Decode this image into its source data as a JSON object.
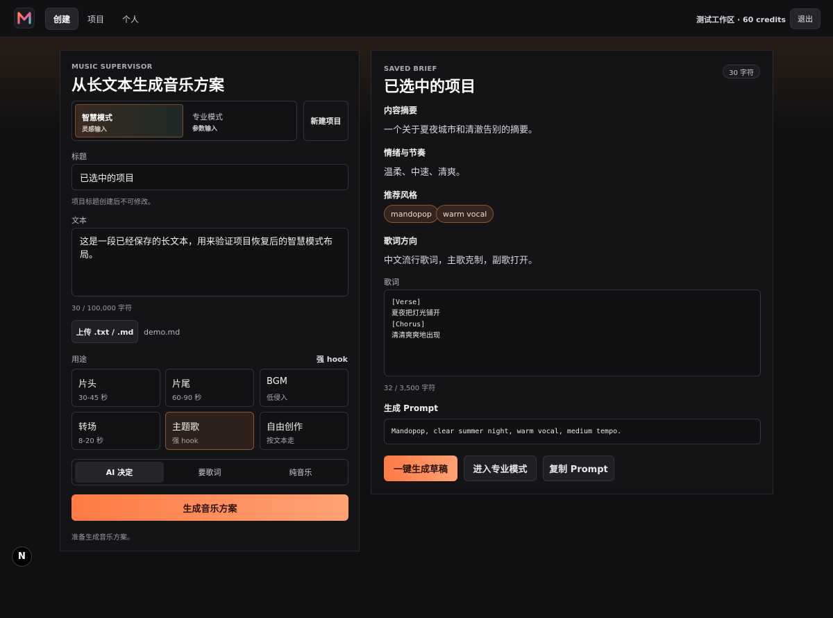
{
  "nav": {
    "tabs": [
      {
        "label": "创建",
        "active": true
      },
      {
        "label": "项目",
        "active": false
      },
      {
        "label": "个人",
        "active": false
      }
    ],
    "credits": "测试工作区 · 60 credits",
    "logout": "退出"
  },
  "left": {
    "eyebrow": "MUSIC SUPERVISOR",
    "title": "从长文本生成音乐方案",
    "modes": {
      "smart": {
        "title": "智慧模式",
        "sub": "灵感输入"
      },
      "pro": {
        "title": "专业模式",
        "sub": "参数输入"
      },
      "new_project": "新建项目"
    },
    "title_label": "标题",
    "title_value": "已选中的项目",
    "title_hint": "项目标题创建后不可修改。",
    "text_label": "文本",
    "text_value": "这是一段已经保存的长文本，用来验证项目恢复后的智慧模式布局。",
    "text_count": "30 / 100,000 字符",
    "upload_label": "上传 .txt / .md",
    "upload_file": "demo.md",
    "usage_label": "用途",
    "usage_selected": "强 hook",
    "usages": [
      {
        "title": "片头",
        "sub": "30-45 秒",
        "selected": false
      },
      {
        "title": "片尾",
        "sub": "60-90 秒",
        "selected": false
      },
      {
        "title": "BGM",
        "sub": "低侵入",
        "selected": false
      },
      {
        "title": "转场",
        "sub": "8-20 秒",
        "selected": false
      },
      {
        "title": "主题歌",
        "sub": "强 hook",
        "selected": true
      },
      {
        "title": "自由创作",
        "sub": "按文本走",
        "selected": false
      }
    ],
    "lyrics_options": [
      {
        "label": "AI 决定",
        "active": true
      },
      {
        "label": "要歌词",
        "active": false
      },
      {
        "label": "纯音乐",
        "active": false
      }
    ],
    "generate": "生成音乐方案",
    "status": "准备生成音乐方案。"
  },
  "right": {
    "eyebrow": "SAVED BRIEF",
    "title": "已选中的项目",
    "count_badge": "30 字符",
    "summary_label": "内容摘要",
    "summary": "一个关于夏夜城市和清澈告别的摘要。",
    "mood_label": "情绪与节奏",
    "mood": "温柔、中速、清爽。",
    "style_label": "推荐风格",
    "styles": [
      "mandopop",
      "warm vocal"
    ],
    "lyric_dir_label": "歌词方向",
    "lyric_dir": "中文流行歌词，主歌克制，副歌打开。",
    "lyrics_label": "歌词",
    "lyrics_lines": [
      "[Verse]",
      "夏夜把灯光铺开",
      "[Chorus]",
      "清清爽爽地出现"
    ],
    "lyrics_count": "32 / 3,500 字符",
    "prompt_label": "生成 Prompt",
    "prompt": "Mandopop, clear summer night, warm vocal, medium tempo.",
    "btn_draft": "一键生成草稿",
    "btn_pro": "进入专业模式",
    "btn_copy": "复制 Prompt"
  },
  "badge": "N",
  "colors": {
    "accent": "#ff7a45",
    "background": "#101012",
    "panel": "#141417"
  }
}
